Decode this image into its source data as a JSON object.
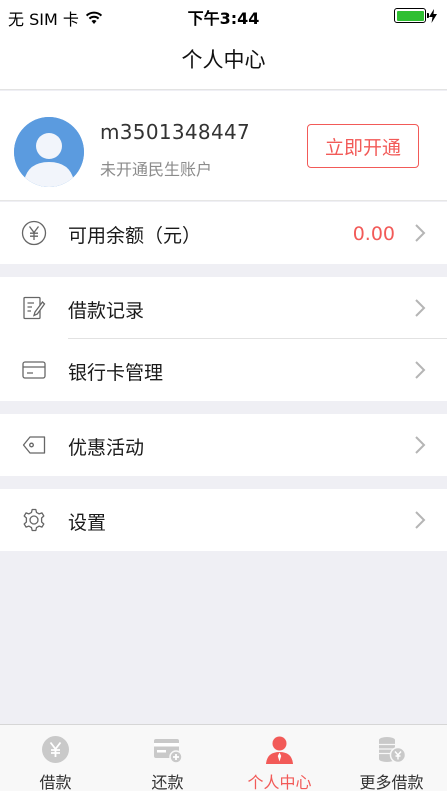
{
  "status_bar": {
    "carrier": "无 SIM 卡",
    "time": "下午3:44"
  },
  "nav": {
    "title": "个人中心"
  },
  "profile": {
    "username": "m3501348447",
    "account_status": "未开通民生账户",
    "open_button": "立即开通"
  },
  "balance": {
    "label": "可用余额（元）",
    "value": "0.00"
  },
  "menu": {
    "loan_records": "借款记录",
    "bank_cards": "银行卡管理",
    "promotions": "优惠活动",
    "settings": "设置"
  },
  "tabs": [
    {
      "label": "借款",
      "icon": "yen-coin-icon"
    },
    {
      "label": "还款",
      "icon": "card-repay-icon"
    },
    {
      "label": "个人中心",
      "icon": "person-icon"
    },
    {
      "label": "更多借款",
      "icon": "coin-stack-icon"
    }
  ],
  "colors": {
    "accent": "#f25a58",
    "avatar": "#5b9bdf",
    "battery": "#2fbf32",
    "inactive_icon": "#c9c9c9"
  }
}
